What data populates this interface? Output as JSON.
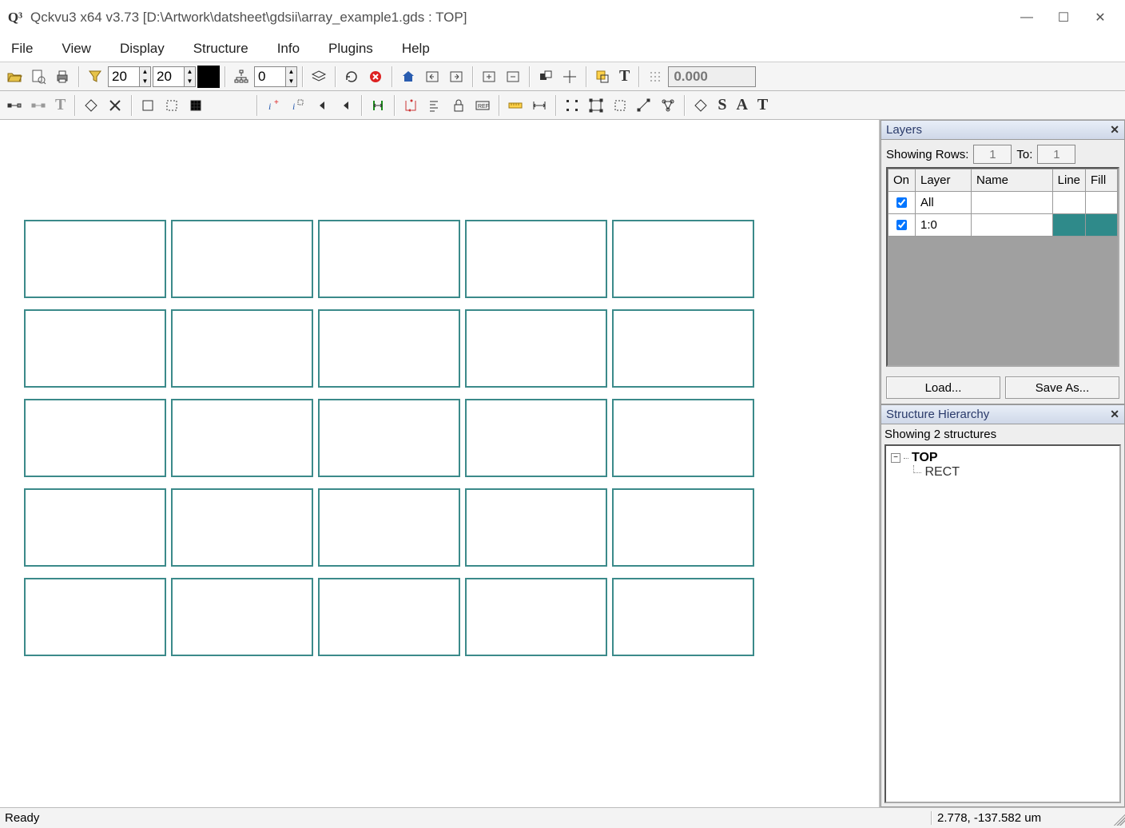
{
  "window": {
    "app_icon": "Q³",
    "title": "Qckvu3 x64 v3.73 [D:\\Artwork\\datsheet\\gdsii\\array_example1.gds : TOP]"
  },
  "menu": {
    "items": [
      "File",
      "View",
      "Display",
      "Structure",
      "Info",
      "Plugins",
      "Help"
    ]
  },
  "toolbar1": {
    "spin1": "20",
    "spin2": "20",
    "spin3": "0",
    "readout": "0.000"
  },
  "layers_panel": {
    "title": "Layers",
    "showing_rows_label": "Showing Rows:",
    "rows_from": "1",
    "to_label": "To:",
    "rows_to": "1",
    "headers": {
      "on": "On",
      "layer": "Layer",
      "name": "Name",
      "line": "Line",
      "fill": "Fill"
    },
    "rows": [
      {
        "on": true,
        "layer": "All",
        "name": "",
        "line": "",
        "fill": ""
      },
      {
        "on": true,
        "layer": "1:0",
        "name": "",
        "line": "#2f8a8a",
        "fill": "#2f8a8a"
      }
    ],
    "load_btn": "Load...",
    "saveas_btn": "Save As..."
  },
  "structure_panel": {
    "title": "Structure Hierarchy",
    "summary": "Showing 2 structures",
    "root": "TOP",
    "child": "RECT"
  },
  "statusbar": {
    "left": "Ready",
    "right": "2.778, -137.582 um"
  },
  "canvas": {
    "grid_rows": 5,
    "grid_cols": 5
  }
}
